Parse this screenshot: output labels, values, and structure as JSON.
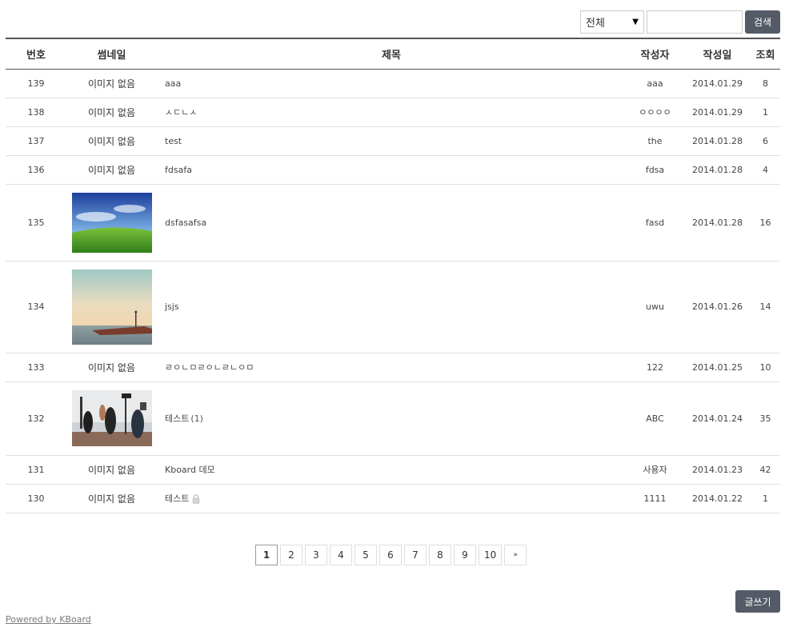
{
  "search": {
    "select_value": "전체",
    "input_value": "",
    "button_label": "검색"
  },
  "table": {
    "headers": {
      "number": "번호",
      "thumbnail": "썸네일",
      "title": "제목",
      "author": "작성자",
      "date": "작성일",
      "views": "조회"
    },
    "rows": [
      {
        "number": "139",
        "thumbnail": "이미지 없음",
        "title": "aaa",
        "comments": "",
        "locked": false,
        "author": "aaa",
        "date": "2014.01.29",
        "views": "8"
      },
      {
        "number": "138",
        "thumbnail": "이미지 없음",
        "title": "ㅅㄷㄴㅅ",
        "comments": "",
        "locked": false,
        "author": "ㅇㅇㅇㅇ",
        "date": "2014.01.29",
        "views": "1"
      },
      {
        "number": "137",
        "thumbnail": "이미지 없음",
        "title": "test",
        "comments": "",
        "locked": false,
        "author": "the",
        "date": "2014.01.28",
        "views": "6"
      },
      {
        "number": "136",
        "thumbnail": "이미지 없음",
        "title": "fdsafa",
        "comments": "",
        "locked": false,
        "author": "fdsa",
        "date": "2014.01.28",
        "views": "4"
      },
      {
        "number": "135",
        "thumbnail": "image:green-field",
        "title": "dsfasafsa",
        "comments": "",
        "locked": false,
        "author": "fasd",
        "date": "2014.01.28",
        "views": "16"
      },
      {
        "number": "134",
        "thumbnail": "image:sunset-pier",
        "title": "jsjs",
        "comments": "",
        "locked": false,
        "author": "uwu",
        "date": "2014.01.26",
        "views": "14"
      },
      {
        "number": "133",
        "thumbnail": "이미지 없음",
        "title": "ㄹㅇㄴㅁㄹㅇㄴㄹㄴㅇㅁ",
        "comments": "",
        "locked": false,
        "author": "122",
        "date": "2014.01.25",
        "views": "10"
      },
      {
        "number": "132",
        "thumbnail": "image:film-set",
        "title": "테스트",
        "comments": "(1)",
        "locked": false,
        "author": "ABC",
        "date": "2014.01.24",
        "views": "35"
      },
      {
        "number": "131",
        "thumbnail": "이미지 없음",
        "title": "Kboard 데모",
        "comments": "",
        "locked": false,
        "author": "사용자",
        "date": "2014.01.23",
        "views": "42"
      },
      {
        "number": "130",
        "thumbnail": "이미지 없음",
        "title": "테스트",
        "comments": "",
        "locked": true,
        "author": "1111",
        "date": "2014.01.22",
        "views": "1"
      }
    ]
  },
  "pagination": {
    "pages": [
      "1",
      "2",
      "3",
      "4",
      "5",
      "6",
      "7",
      "8",
      "9",
      "10"
    ],
    "current": "1",
    "next_label": "»"
  },
  "write_button": "글쓰기",
  "footer": {
    "powered": "Powered by KBoard"
  },
  "colors": {
    "button_bg": "#545b66",
    "header_border": "#555555"
  },
  "icons": {
    "lock": "lock-icon"
  }
}
